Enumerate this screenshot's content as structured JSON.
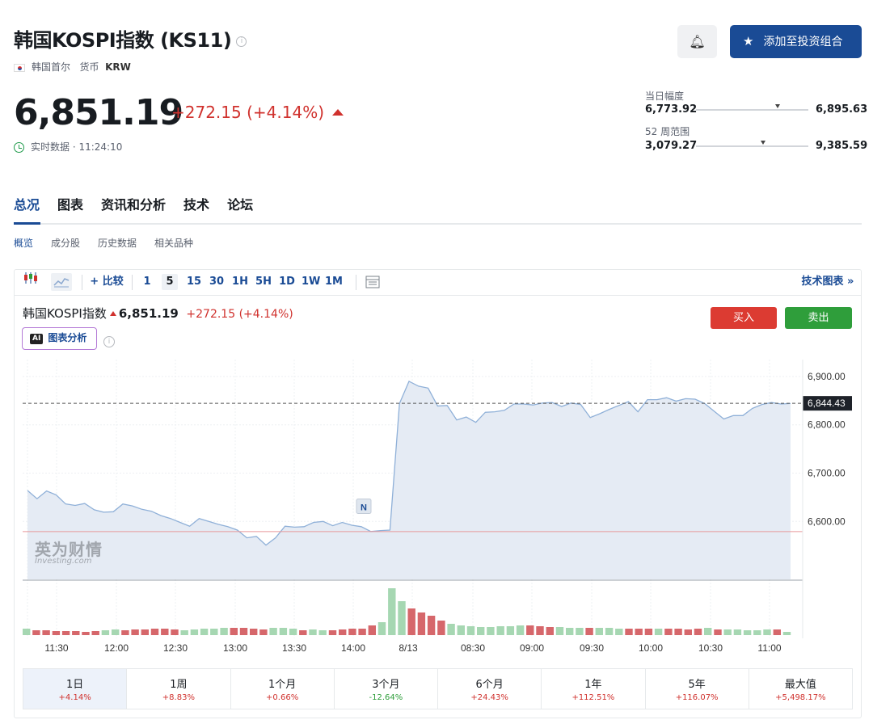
{
  "header": {
    "title": "韩国KOSPI指数 (KS11)",
    "exchange": "韩国首尔",
    "currency_label": "货币",
    "currency": "KRW",
    "add_portfolio_label": "添加至投资组合"
  },
  "quote": {
    "price": "6,851.19",
    "change": "+272.15 (+4.14%)",
    "realtime_label": "实时数据 · 11:24:10"
  },
  "ranges": {
    "day_label": "当日幅度",
    "day_low": "6,773.92",
    "day_high": "6,895.63",
    "day_position": 0.73,
    "week52_label": "52 周范围",
    "week52_low": "3,079.27",
    "week52_high": "9,385.59",
    "week52_position": 0.6
  },
  "tabs": [
    "总况",
    "图表",
    "资讯和分析",
    "技术",
    "论坛"
  ],
  "subtabs": [
    "概览",
    "成分股",
    "历史数据",
    "相关品种"
  ],
  "toolbar": {
    "compare": "比较",
    "intervals": [
      "1",
      "5",
      "15",
      "30",
      "1H",
      "5H",
      "1D",
      "1W",
      "1M"
    ],
    "selected_interval": "5",
    "tech_chart": "技术图表 »"
  },
  "chart_header": {
    "name": "韩国KOSPI指数",
    "price": "6,851.19",
    "change": "+272.15 (+4.14%)",
    "ai_label": "图表分析",
    "ai_badge": "AI",
    "buy": "买入",
    "sell": "卖出",
    "watermark_zh": "英为财情",
    "watermark_en": "Investing.com",
    "news_marker": "N"
  },
  "chart_data": {
    "type": "area",
    "x_labels": [
      "11:30",
      "12:00",
      "12:30",
      "13:00",
      "13:30",
      "14:00",
      "8/13",
      "08:30",
      "09:00",
      "09:30",
      "10:00",
      "10:30",
      "11:00"
    ],
    "y_ticks": [
      "6,900.00",
      "6,800.00",
      "6,700.00",
      "6,600.00"
    ],
    "ylim": [
      6480,
      6935
    ],
    "prev_close": 6579,
    "current_label": "6,844.43",
    "current_value": 6844.43,
    "values": [
      6664,
      6647,
      6663,
      6655,
      6636,
      6633,
      6637,
      6624,
      6619,
      6620,
      6636,
      6632,
      6625,
      6621,
      6612,
      6606,
      6598,
      6590,
      6606,
      6600,
      6594,
      6589,
      6582,
      6566,
      6569,
      6551,
      6566,
      6590,
      6588,
      6589,
      6598,
      6600,
      6591,
      6598,
      6592,
      6589,
      6579,
      6581,
      6582,
      6844,
      6890,
      6880,
      6876,
      6839,
      6840,
      6810,
      6816,
      6805,
      6826,
      6827,
      6830,
      6843,
      6843,
      6841,
      6845,
      6846,
      6838,
      6845,
      6842,
      6815,
      6823,
      6832,
      6840,
      6848,
      6827,
      6852,
      6852,
      6856,
      6849,
      6854,
      6853,
      6844,
      6828,
      6812,
      6819,
      6819,
      6834,
      6842,
      6846,
      6843,
      6844
    ],
    "volume": [
      8,
      6,
      6,
      5,
      5,
      5,
      4,
      5,
      6,
      7,
      6,
      7,
      7,
      8,
      8,
      7,
      6,
      7,
      8,
      8,
      9,
      9,
      9,
      8,
      7,
      9,
      9,
      8,
      6,
      7,
      6,
      6,
      7,
      8,
      8,
      12,
      16,
      58,
      42,
      33,
      28,
      24,
      18,
      14,
      12,
      11,
      10,
      10,
      11,
      11,
      12,
      12,
      11,
      10,
      10,
      9,
      9,
      9,
      9,
      9,
      8,
      8,
      8,
      8,
      8,
      8,
      8,
      7,
      8,
      9,
      7,
      7,
      7,
      6,
      6,
      7,
      7,
      4
    ],
    "volume_up": [
      true,
      false,
      false,
      false,
      false,
      false,
      false,
      false,
      true,
      true,
      false,
      false,
      false,
      false,
      false,
      false,
      true,
      true,
      true,
      true,
      true,
      false,
      false,
      false,
      false,
      true,
      true,
      true,
      false,
      true,
      true,
      false,
      false,
      false,
      false,
      false,
      true,
      true,
      true,
      false,
      false,
      false,
      false,
      true,
      true,
      true,
      true,
      true,
      true,
      true,
      true,
      false,
      false,
      false,
      true,
      true,
      true,
      false,
      true,
      true,
      true,
      false,
      false,
      false,
      true,
      false,
      false,
      false,
      false,
      true,
      false,
      true,
      true,
      true,
      true,
      true,
      false,
      true
    ],
    "colors": {
      "line": "#8fb0d8",
      "fill": "#e5ebf4",
      "up": "#a6d7b2",
      "down": "#d6676b",
      "prev_close": "#e8989a"
    }
  },
  "performance": [
    {
      "period": "1日",
      "value": "+4.14%",
      "dir": "pos"
    },
    {
      "period": "1周",
      "value": "+8.83%",
      "dir": "pos"
    },
    {
      "period": "1个月",
      "value": "+0.66%",
      "dir": "pos"
    },
    {
      "period": "3个月",
      "value": "-12.64%",
      "dir": "neg"
    },
    {
      "period": "6个月",
      "value": "+24.43%",
      "dir": "pos"
    },
    {
      "period": "1年",
      "value": "+112.51%",
      "dir": "pos"
    },
    {
      "period": "5年",
      "value": "+116.07%",
      "dir": "pos"
    },
    {
      "period": "最大值",
      "value": "+5,498.17%",
      "dir": "pos"
    }
  ]
}
